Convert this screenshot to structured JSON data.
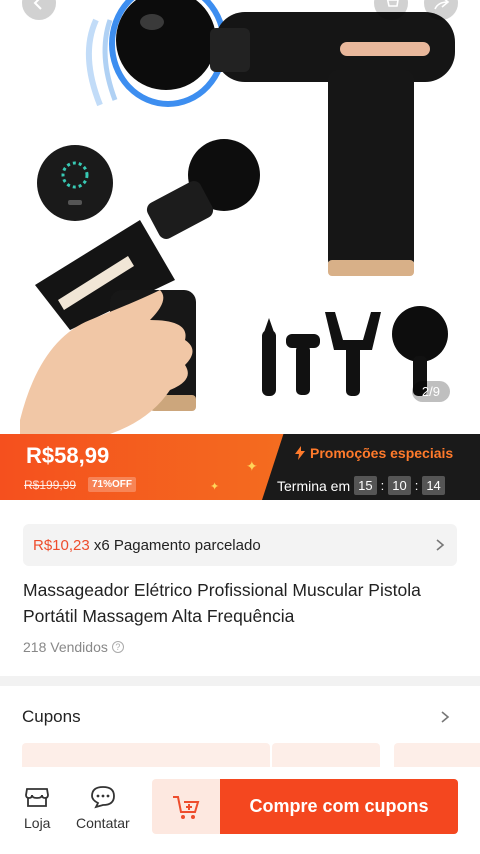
{
  "product_image": {
    "counter": "2/9"
  },
  "price": {
    "current": "R$58,99",
    "original": "R$199,99",
    "discount": "71%OFF",
    "promo_label": "Promoções especiais",
    "ends_label": "Termina em",
    "countdown": {
      "hours": "15",
      "minutes": "10",
      "seconds": "14"
    }
  },
  "installment": {
    "amount": "R$10,23",
    "text": " x6 Pagamento parcelado"
  },
  "product": {
    "title": "Massageador Elétrico Profissional Muscular Pistola Portátil Massagem Alta Frequência",
    "sold": "218 Vendidos"
  },
  "coupons": {
    "title": "Cupons"
  },
  "bottom_bar": {
    "store_label": "Loja",
    "contact_label": "Contatar",
    "buy_label": "Compre com cupons"
  },
  "colors": {
    "accent": "#ee4d2d",
    "buy_button": "#f4471f",
    "dark_panel": "#1a1a1a"
  },
  "icons": [
    "back-icon",
    "cart-icon",
    "share-icon",
    "chevron-right-icon",
    "question-icon",
    "store-icon",
    "chat-icon",
    "add-to-cart-icon",
    "lightning-icon"
  ]
}
